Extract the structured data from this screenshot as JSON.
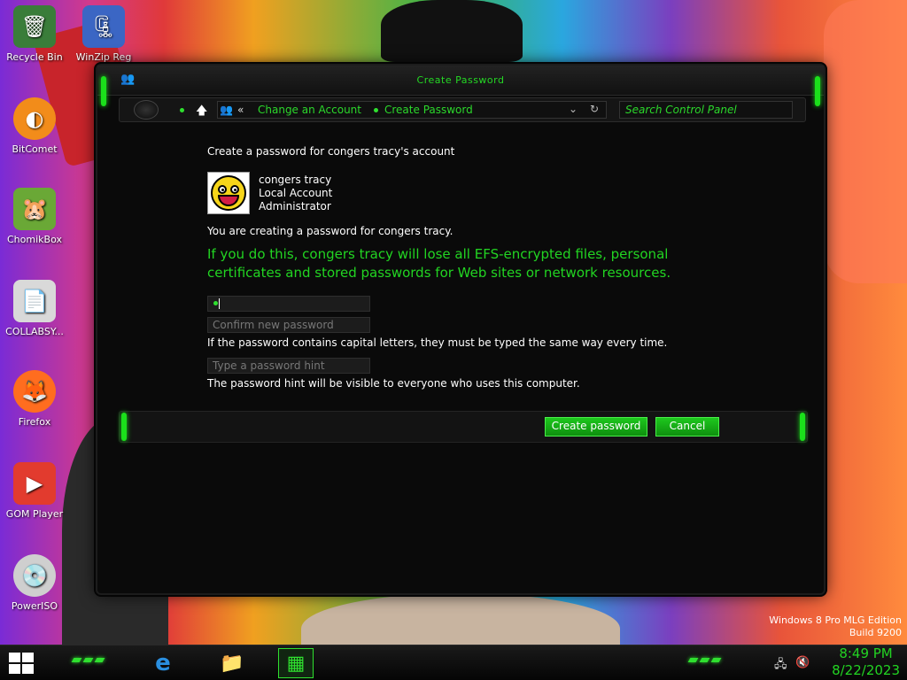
{
  "desktop": {
    "icons": [
      {
        "label": "Recycle Bin",
        "icon": "recycle-bin-icon",
        "glyph": "🗑",
        "color": "#3a7d3a"
      },
      {
        "label": "WinZip Reg",
        "icon": "winzip-icon",
        "glyph": "🗜",
        "color": "#3b66c4"
      },
      {
        "label": "BitComet",
        "icon": "bitcomet-icon",
        "glyph": "◐",
        "color": "#f28c1a"
      },
      {
        "label": "ChomikBox",
        "icon": "chomikbox-icon",
        "glyph": "🐹",
        "color": "#6aa836"
      },
      {
        "label": "COLLABSY...",
        "icon": "collabsy-icon",
        "glyph": "📄",
        "color": "#d9d9d9"
      },
      {
        "label": "Firefox",
        "icon": "firefox-icon",
        "glyph": "🦊",
        "color": "#ff6d1f"
      },
      {
        "label": "GOM Player",
        "icon": "gom-player-icon",
        "glyph": "▶",
        "color": "#e23b2e"
      },
      {
        "label": "PowerISO",
        "icon": "poweriso-icon",
        "glyph": "💿",
        "color": "#cfcfcf"
      }
    ],
    "watermark_line1": "Windows 8 Pro MLG Edition",
    "watermark_line2": "Build 9200"
  },
  "window": {
    "title": "Create Password",
    "breadcrumb_chevron": "«",
    "breadcrumb": [
      "Change an Account",
      "Create Password"
    ],
    "search_placeholder": "Search Control Panel",
    "up_glyph": "🡅",
    "dropdown_glyph": "⌄",
    "refresh_glyph": "↻"
  },
  "content": {
    "heading": "Create a password for congers tracy's account",
    "account_name": "congers tracy",
    "account_type": "Local Account",
    "account_role": "Administrator",
    "creating_text": "You are creating a password for congers tracy.",
    "warning": "If you do this, congers tracy will lose all EFS-encrypted files, personal certificates and stored passwords for Web sites or network resources.",
    "new_password_value": "",
    "confirm_placeholder": "Confirm new password",
    "caps_note": "If the password contains capital letters, they must be typed the same way every time.",
    "hint_placeholder": "Type a password hint",
    "hint_note": "The password hint will be visible to everyone who uses this computer."
  },
  "buttons": {
    "create": "Create password",
    "cancel": "Cancel"
  },
  "taskbar": {
    "apps": [
      {
        "name": "internet-explorer",
        "glyph": "e",
        "color": "#2a8fe0"
      },
      {
        "name": "file-explorer",
        "glyph": "📁",
        "color": "#f2c14e"
      },
      {
        "name": "control-panel",
        "glyph": "▦",
        "color": "#2fe02f"
      }
    ],
    "time": "8:49 PM",
    "date": "8/22/2023"
  },
  "colors": {
    "accent_green": "#22d422",
    "window_bg": "#0a0a0a",
    "button_green": "#1ec81e"
  }
}
